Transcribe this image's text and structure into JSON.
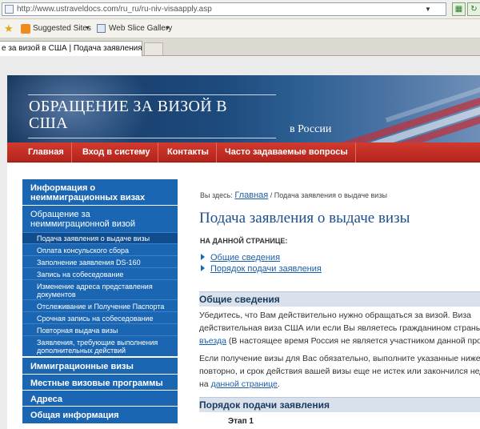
{
  "browser": {
    "url": "http://www.ustraveldocs.com/ru_ru/ru-niv-visaapply.asp",
    "favorites": [
      {
        "label": "Suggested Sites",
        "icon": "suggested-sites-icon"
      },
      {
        "label": "Web Slice Gallery",
        "icon": "web-slice-icon"
      }
    ],
    "tab_title": "е за визой в США | Подача заявления о ..."
  },
  "banner": {
    "title": "ОБРАЩЕНИЕ ЗА ВИЗОЙ В США",
    "subtitle": "в России"
  },
  "nav": [
    "Главная",
    "Вход в систему",
    "Контакты",
    "Часто задаваемые вопросы"
  ],
  "sidebar": {
    "sections": [
      {
        "label": "Информация о неиммиграционных визах"
      },
      {
        "label": "Обращение за неиммиграционной визой"
      }
    ],
    "subitems": [
      {
        "label": "Подача заявления о выдаче визы",
        "active": true
      },
      {
        "label": "Оплата консульского сбора"
      },
      {
        "label": "Заполнение заявления DS-160"
      },
      {
        "label": "Запись на собеседование"
      },
      {
        "label": "Изменение адреса представления документов"
      },
      {
        "label": "Отслеживание и Получение Паспорта"
      },
      {
        "label": "Срочная запись на собеседование"
      },
      {
        "label": "Повторная выдача визы"
      },
      {
        "label": "Заявления, требующие выполнения дополнительных действий"
      }
    ],
    "bottom_sections": [
      {
        "label": "Иммиграционные визы"
      },
      {
        "label": "Местные визовые программы"
      },
      {
        "label": "Адреса"
      },
      {
        "label": "Общая информация"
      }
    ]
  },
  "main": {
    "breadcrumb_prefix": "Вы здесь:",
    "breadcrumb_link": "Главная",
    "breadcrumb_current": "/ Подача заявления о выдаче визы",
    "heading": "Подача заявления о выдаче визы",
    "on_page_label": "НА ДАННОЙ СТРАНИЦЕ:",
    "toc": [
      "Общие сведения",
      "Порядок подачи заявления"
    ],
    "section1_title": "Общие сведения",
    "p1_line1": "Убедитесь, что Вам действительно нужно обращаться за визой. Виза",
    "p1_line2": "действительная виза США или если Вы являетесь гражданином страны -",
    "p1_link": "въезда",
    "p1_line3_rest": " (В настоящее время Россия не является участником данной програ",
    "p2_line1": "Если получение визы для Вас обязательно, выполните указанные ниже дей",
    "p2_line2": "повторно, и срок действия вашей визы еще не истек или закончился недавн",
    "p2_line3_prefix": "на ",
    "p2_link": "данной странице",
    "p2_line3_suffix": ".",
    "section2_title": "Порядок подачи заявления",
    "step1": "Этап 1"
  }
}
